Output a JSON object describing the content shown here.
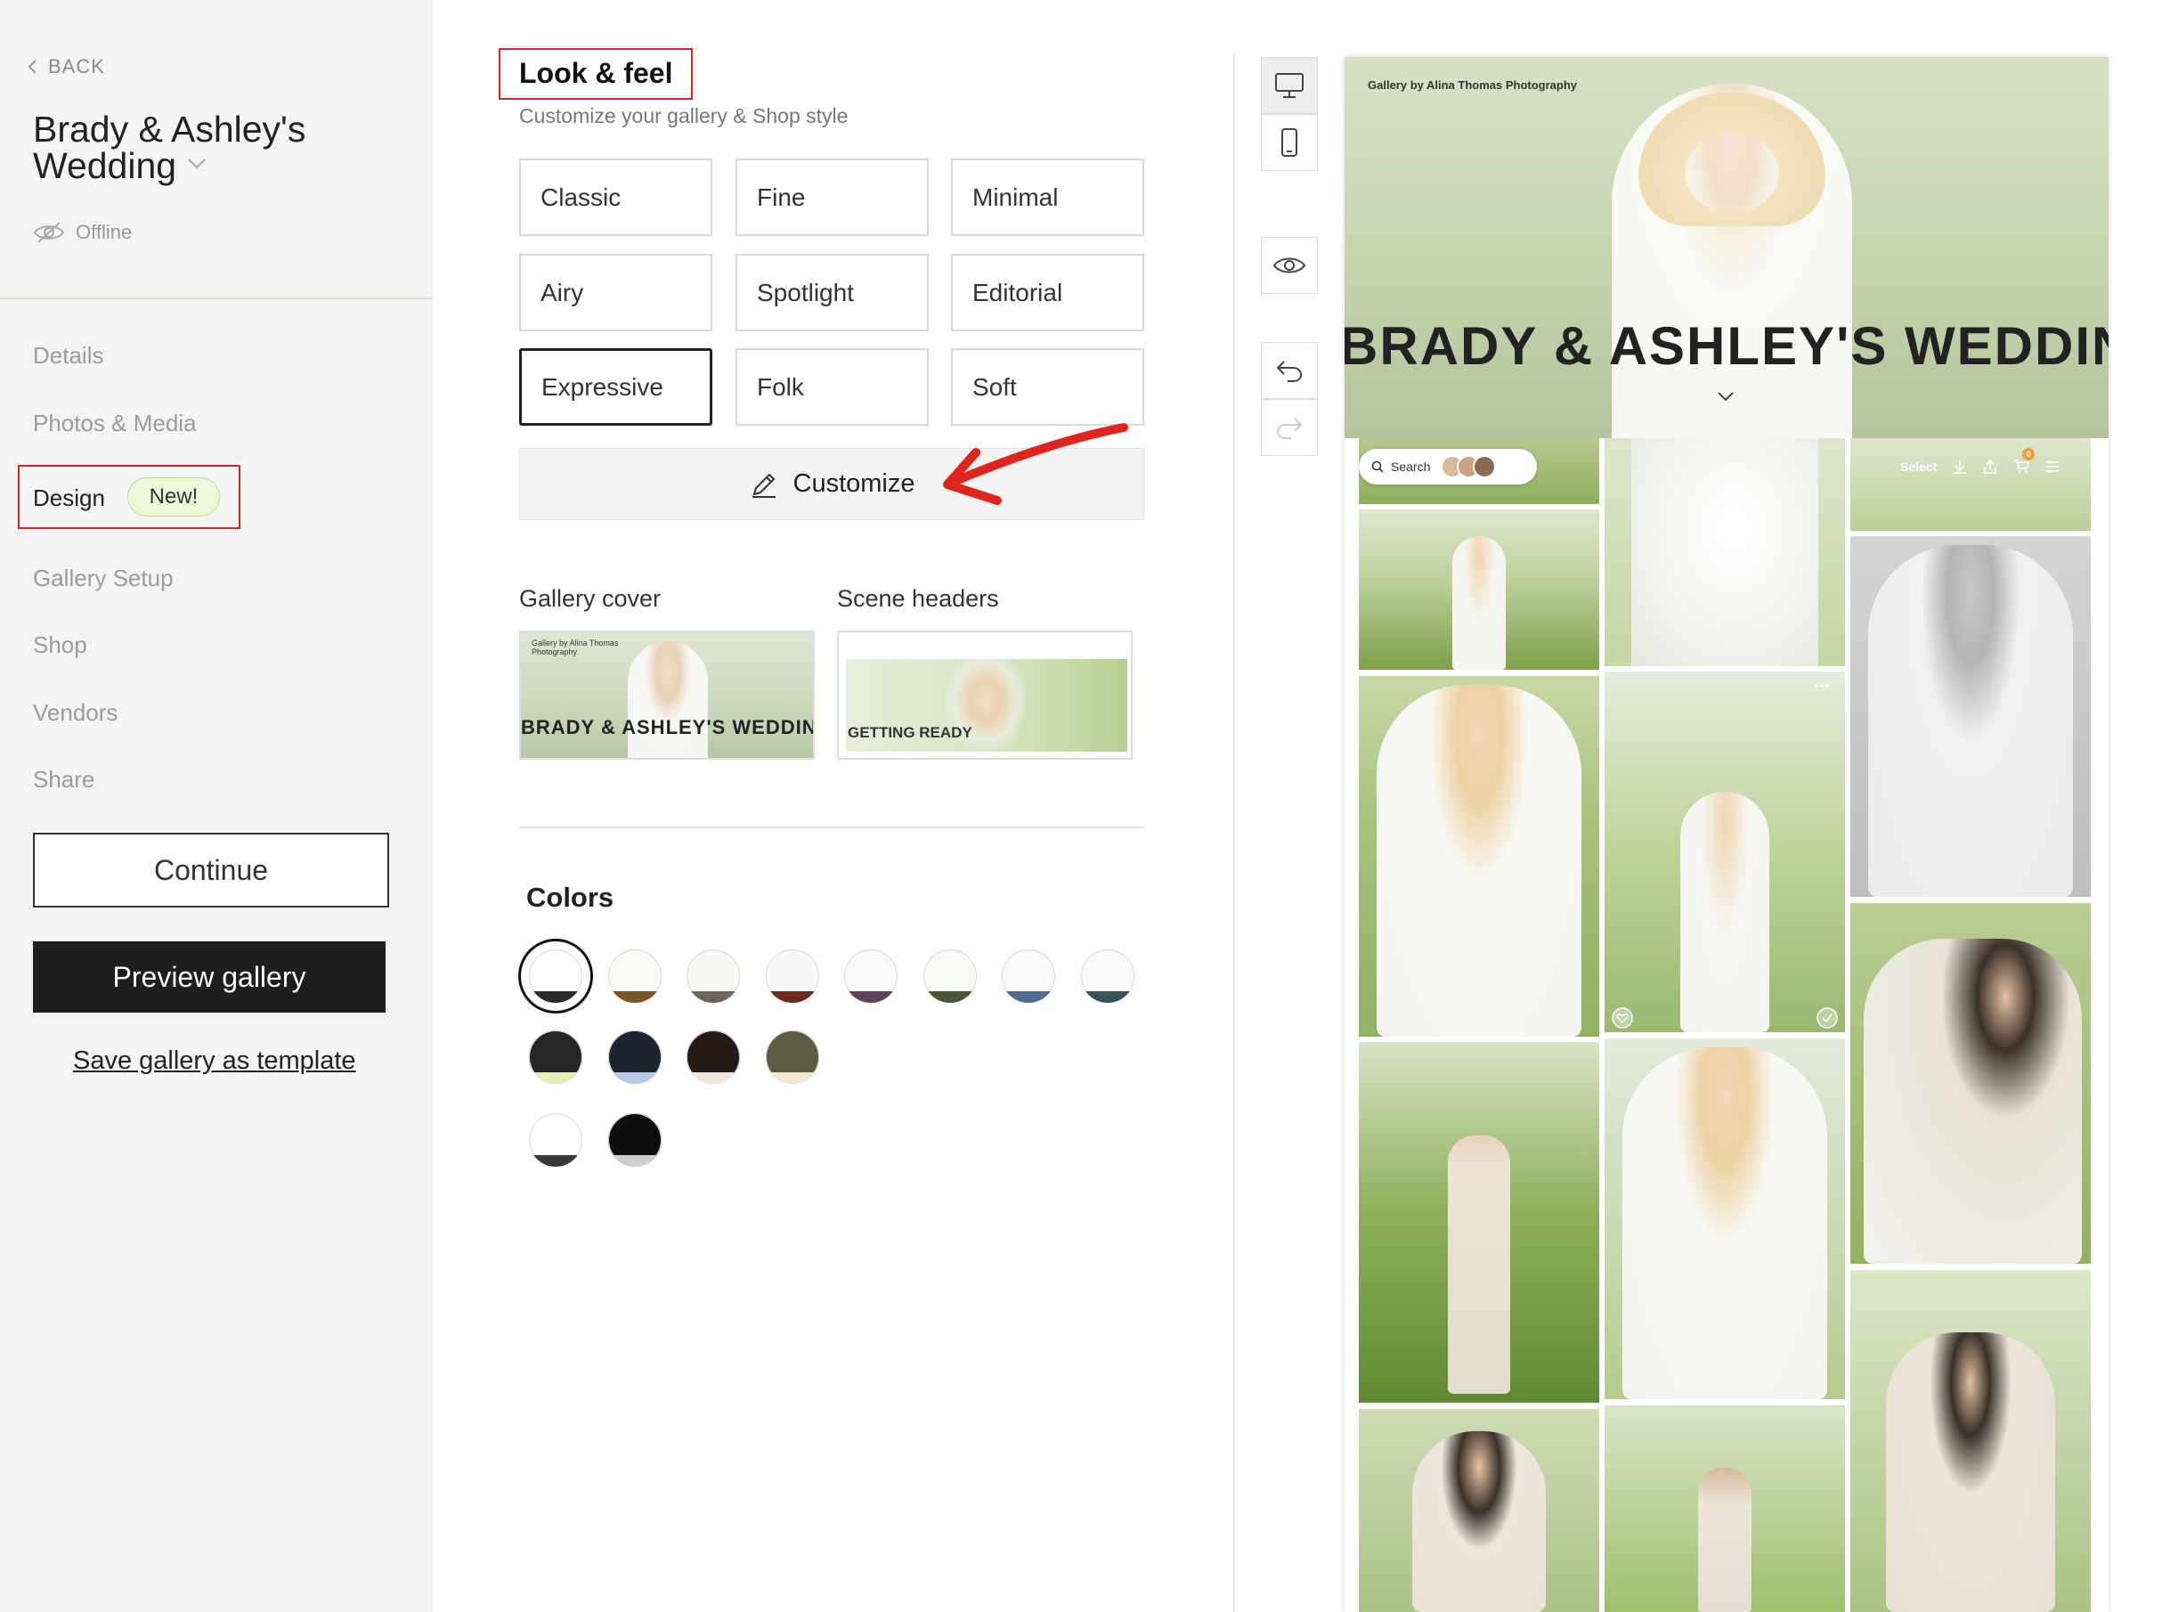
{
  "sidebar": {
    "back_label": "BACK",
    "gallery_title": "Brady & Ashley's Wedding",
    "status": "Offline",
    "nav": [
      {
        "label": "Details"
      },
      {
        "label": "Photos & Media"
      },
      {
        "label": "Design",
        "badge": "New!",
        "active": true
      },
      {
        "label": "Gallery Setup"
      },
      {
        "label": "Shop"
      },
      {
        "label": "Vendors"
      },
      {
        "label": "Share"
      }
    ],
    "continue_label": "Continue",
    "preview_label": "Preview gallery",
    "save_template_label": "Save gallery as template"
  },
  "look_feel": {
    "title": "Look & feel",
    "subtitle": "Customize your gallery & Shop style",
    "styles": [
      "Classic",
      "Fine",
      "Minimal",
      "Airy",
      "Spotlight",
      "Editorial",
      "Expressive",
      "Folk",
      "Soft"
    ],
    "selected_style": "Expressive",
    "customize_label": "Customize"
  },
  "headers": {
    "gallery_cover_label": "Gallery cover",
    "scene_headers_label": "Scene headers",
    "cover_thumb_brand": "Gallery by Alina Thomas Photography",
    "cover_thumb_title": "BRADY & ASHLEY'S WEDDIN",
    "scene_thumb_text": "GETTING READY"
  },
  "colors": {
    "title": "Colors",
    "selected_index": 0,
    "swatches": [
      {
        "base": "#ffffff",
        "accent": "#2b2b2b"
      },
      {
        "base": "#fbf9f4",
        "accent": "#7a5526"
      },
      {
        "base": "#f9f8f5",
        "accent": "#6e655a"
      },
      {
        "base": "#faf8f6",
        "accent": "#6e2a22"
      },
      {
        "base": "#faf9fa",
        "accent": "#5c4359"
      },
      {
        "base": "#f9faf6",
        "accent": "#4b5634"
      },
      {
        "base": "#f9fafb",
        "accent": "#4f6a8c"
      },
      {
        "base": "#f9fafa",
        "accent": "#37565c"
      },
      {
        "base": "#262626",
        "accent": "#e6efb6"
      },
      {
        "base": "#1d2430",
        "accent": "#b8cbe6"
      },
      {
        "base": "#251a16",
        "accent": "#efe6dc"
      },
      {
        "base": "#5e5b43",
        "accent": "#f0e7cf"
      },
      {
        "base": "#ffffff",
        "accent": "#3a3a3a"
      },
      {
        "base": "#0e0e0e",
        "accent": "#cfcfcf"
      }
    ]
  },
  "toolbar": {
    "desktop_icon": "desktop-icon",
    "mobile_icon": "mobile-icon",
    "eye_icon": "eye-icon",
    "undo_icon": "undo-icon",
    "redo_icon": "redo-icon"
  },
  "preview": {
    "brand": "Gallery by Alina Thomas Photography",
    "title": "BRADY & ASHLEY'S WEDDIN",
    "search_label": "Search",
    "select_label": "Select",
    "cart_count": "0"
  }
}
